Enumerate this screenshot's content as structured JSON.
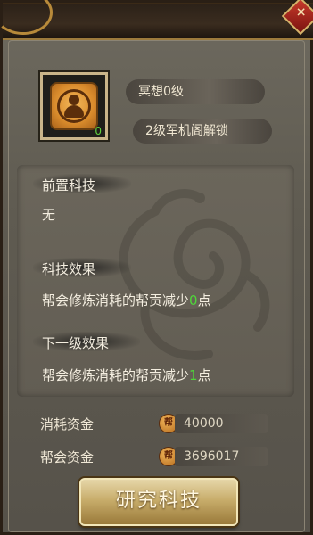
{
  "header": {
    "close_icon": "close-icon",
    "close_glyph": "✕"
  },
  "tech": {
    "icon": "meditation-icon",
    "icon_level": "0",
    "name_level": "冥想0级",
    "unlock": "2级军机阁解锁"
  },
  "details": {
    "prereq_title": "前置科技",
    "prereq_value": "无",
    "effect_title": "科技效果",
    "effect_prefix": "帮会修炼消耗的帮贡减少",
    "effect_num": "0",
    "effect_suffix": "点",
    "next_title": "下一级效果",
    "next_prefix": "帮会修炼消耗的帮贡减少",
    "next_num": "1",
    "next_suffix": "点"
  },
  "costs": {
    "consume_label": "消耗资金",
    "consume_value": "40000",
    "guild_label": "帮会资金",
    "guild_value": "3696017",
    "coin_glyph": "帮"
  },
  "actions": {
    "research_label": "研究科技"
  },
  "colors": {
    "accent_green": "#4fd53a",
    "button_gold": "#c8ad6b"
  }
}
